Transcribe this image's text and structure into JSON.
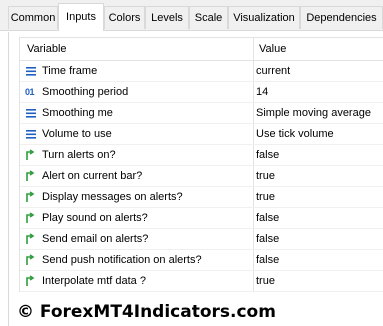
{
  "tabs": [
    "Common",
    "Inputs",
    "Colors",
    "Levels",
    "Scale",
    "Visualization",
    "Dependencies"
  ],
  "active_tab": "Inputs",
  "table": {
    "headers": {
      "variable": "Variable",
      "value": "Value"
    },
    "rows": [
      {
        "icon": "enum-icon",
        "name": "Time frame",
        "value": "current"
      },
      {
        "icon": "integer-icon",
        "name": "Smoothing period",
        "value": "14"
      },
      {
        "icon": "enum-icon",
        "name": "Smoothing me",
        "value": "Simple moving average"
      },
      {
        "icon": "enum-icon",
        "name": "Volume to use",
        "value": "Use tick volume"
      },
      {
        "icon": "bool-arrow-icon",
        "name": "Turn alerts on?",
        "value": "false"
      },
      {
        "icon": "bool-arrow-icon",
        "name": "Alert on current bar?",
        "value": "true"
      },
      {
        "icon": "bool-arrow-icon",
        "name": "Display messages on alerts?",
        "value": "true"
      },
      {
        "icon": "bool-arrow-icon",
        "name": "Play sound on alerts?",
        "value": "false"
      },
      {
        "icon": "bool-arrow-icon",
        "name": "Send email on alerts?",
        "value": "false"
      },
      {
        "icon": "bool-arrow-icon",
        "name": "Send push notification on alerts?",
        "value": "false"
      },
      {
        "icon": "bool-arrow-icon",
        "name": "Interpolate mtf data ?",
        "value": "true"
      }
    ]
  },
  "integer_icon_glyph": "01",
  "footer": "© ForexMT4Indicators.com",
  "colors": {
    "enum_icon": "#1f5fbf",
    "bool_icon": "#2e9e3e"
  }
}
